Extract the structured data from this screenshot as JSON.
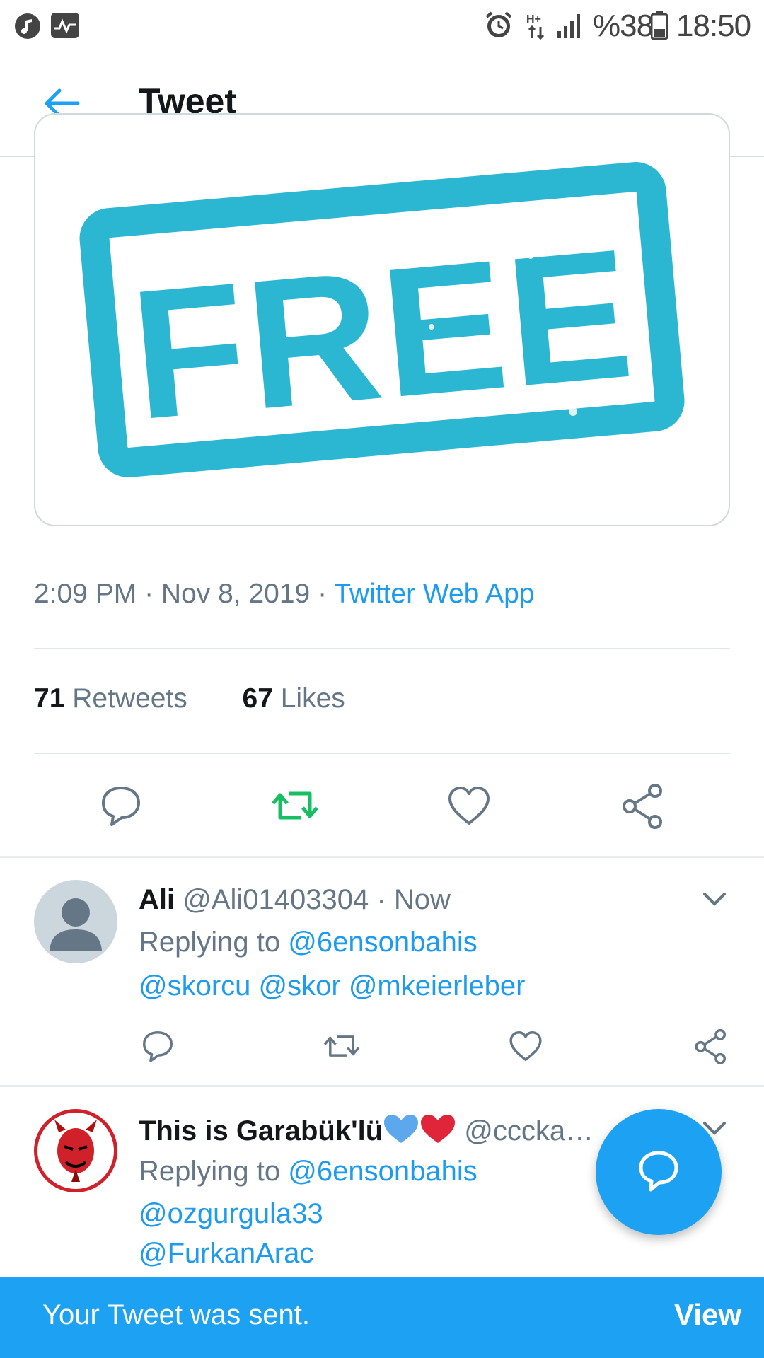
{
  "status_bar": {
    "battery": "%38",
    "time": "18:50",
    "icons": [
      "music-note-icon",
      "activity-icon",
      "alarm-icon",
      "hplus-data-icon",
      "signal-icon",
      "battery-icon"
    ]
  },
  "header": {
    "title": "Tweet",
    "back_icon": "arrow-left-icon"
  },
  "tweet": {
    "image_text": "FREE",
    "time": "2:09 PM",
    "date": "Nov 8, 2019",
    "source": "Twitter Web App",
    "retweets_count": "71",
    "retweets_label": "Retweets",
    "likes_count": "67",
    "likes_label": "Likes",
    "actions": [
      "reply-icon",
      "retweet-icon",
      "like-icon",
      "share-icon"
    ]
  },
  "replies": [
    {
      "name": "Ali",
      "handle": "@Ali01403304",
      "time": "Now",
      "replying_prefix": "Replying to",
      "mentions_line1": "@6ensonbahis",
      "mentions_line2": "@skorcu @skor @mkeierleber"
    },
    {
      "name": "This is Garabük'lü",
      "handle": "@cccka…",
      "replying_prefix": "Replying to",
      "mentions_line1": "@6ensonbahis",
      "mentions_line2": "@ozgurgula33",
      "mentions_line3": "@FurkanArac"
    }
  ],
  "colors": {
    "accent": "#1da1f2",
    "link": "#1d9bf0",
    "retweet_active": "#17bf63",
    "heart": "#e0245e",
    "stamp": "#2bb6d2"
  },
  "snackbar": {
    "message": "Your Tweet was sent.",
    "action": "View"
  }
}
